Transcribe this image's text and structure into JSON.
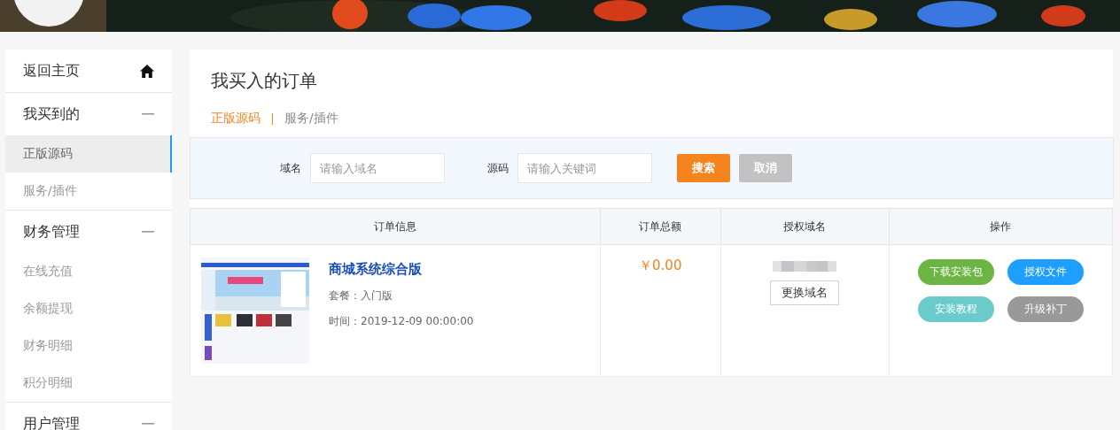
{
  "sidebar": {
    "items": [
      {
        "label": "返回主页",
        "kind": "link"
      },
      {
        "label": "我买到的",
        "kind": "group",
        "expanded": true,
        "children": [
          {
            "label": "正版源码",
            "selected": true
          },
          {
            "label": "服务/插件",
            "selected": false
          }
        ]
      },
      {
        "label": "财务管理",
        "kind": "group",
        "expanded": true,
        "children": [
          {
            "label": "在线充值",
            "selected": false
          },
          {
            "label": "余额提现",
            "selected": false
          },
          {
            "label": "财务明细",
            "selected": false
          },
          {
            "label": "积分明细",
            "selected": false
          }
        ]
      },
      {
        "label": "用户管理",
        "kind": "group",
        "expanded": true
      }
    ]
  },
  "main": {
    "title": "我买入的订单",
    "tabs": [
      {
        "label": "正版源码",
        "selected": true
      },
      {
        "label": "服务/插件",
        "selected": false
      }
    ],
    "filters": [
      {
        "label": "域名",
        "placeholder": "请输入域名"
      },
      {
        "label": "源码",
        "placeholder": "请输入关键词"
      }
    ],
    "buttons": [
      {
        "label": "搜索",
        "kind": "primary"
      },
      {
        "label": "取消",
        "kind": "secondary"
      }
    ],
    "table": {
      "columns": [
        "订单信息",
        "订单总额",
        "授权域名",
        "操作"
      ],
      "rows": [
        {
          "name": "商城系统综合版",
          "package": "套餐：入门版",
          "time": "时间：2019-12-09 00:00:00",
          "amount": "￥0.00",
          "domain_button": "更换域名",
          "actions": [
            {
              "label": "下载安装包",
              "color": "#6db543"
            },
            {
              "label": "授权文件",
              "color": "#1e9fff"
            },
            {
              "label": "安装教程",
              "color": "#6bcbcb"
            },
            {
              "label": "升级补丁",
              "color": "#999999"
            }
          ]
        }
      ]
    }
  }
}
